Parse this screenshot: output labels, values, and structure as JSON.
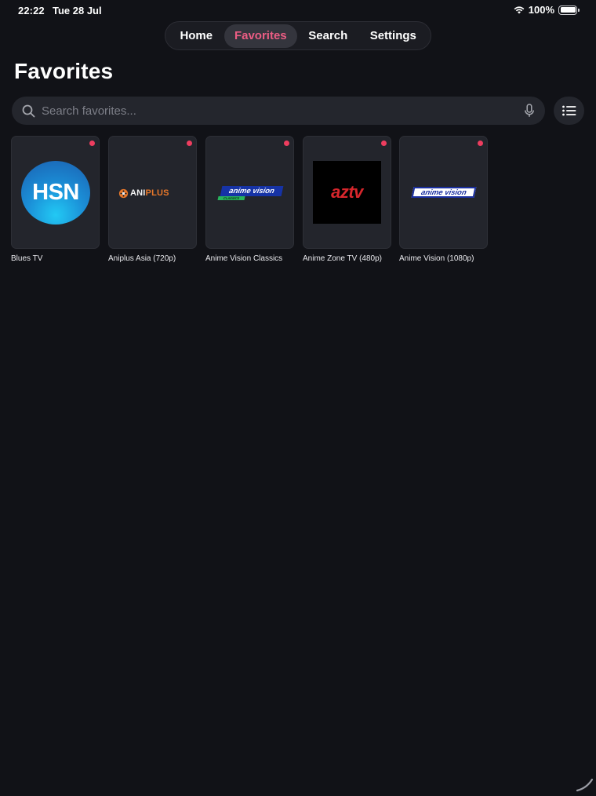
{
  "status": {
    "time": "22:22",
    "date": "Tue 28 Jul",
    "battery": "100%"
  },
  "nav": {
    "tabs": [
      {
        "label": "Home",
        "active": false
      },
      {
        "label": "Favorites",
        "active": true
      },
      {
        "label": "Search",
        "active": false
      },
      {
        "label": "Settings",
        "active": false
      }
    ]
  },
  "page": {
    "title": "Favorites"
  },
  "search": {
    "placeholder": "Search favorites..."
  },
  "colors": {
    "accent": "#ec5d84",
    "background": "#111217",
    "live_dot": "#ee3d5f"
  },
  "favorites": [
    {
      "title": "Blues TV",
      "logo_text": "HSN"
    },
    {
      "title": "Aniplus Asia (720p)",
      "logo_text_a": "ANI",
      "logo_text_b": "PLUS"
    },
    {
      "title": "Anime Vision Classics",
      "logo_text": "anime vision",
      "logo_sub": "CLASSICS"
    },
    {
      "title": "Anime Zone TV (480p)",
      "logo_text": "aztv"
    },
    {
      "title": "Anime Vision (1080p)",
      "logo_text": "anime vision"
    }
  ]
}
